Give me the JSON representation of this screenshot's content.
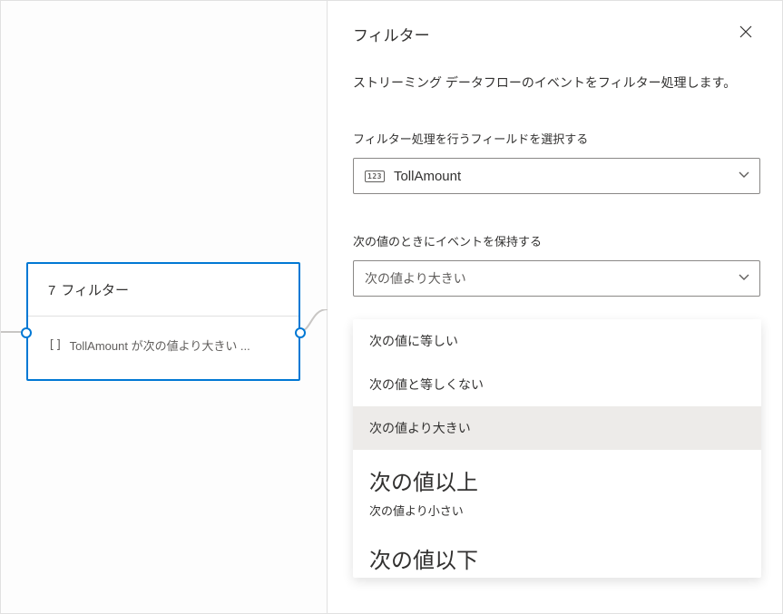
{
  "canvas": {
    "node": {
      "index": "7",
      "title": "フィルター",
      "summary": "TollAmount が次の値より大きい ..."
    }
  },
  "panel": {
    "title": "フィルター",
    "description": "ストリーミング データフローのイベントをフィルター処理します。",
    "field_select": {
      "label": "フィルター処理を行うフィールドを選択する",
      "type_badge": "123",
      "value": "TollAmount"
    },
    "condition_select": {
      "label": "次の値のときにイベントを保持する",
      "value": "次の値より大きい",
      "options": [
        "次の値に等しい",
        "次の値と等しくない",
        "次の値より大きい",
        "次の値以上",
        "次の値より小さい",
        "次の値以下"
      ]
    }
  }
}
